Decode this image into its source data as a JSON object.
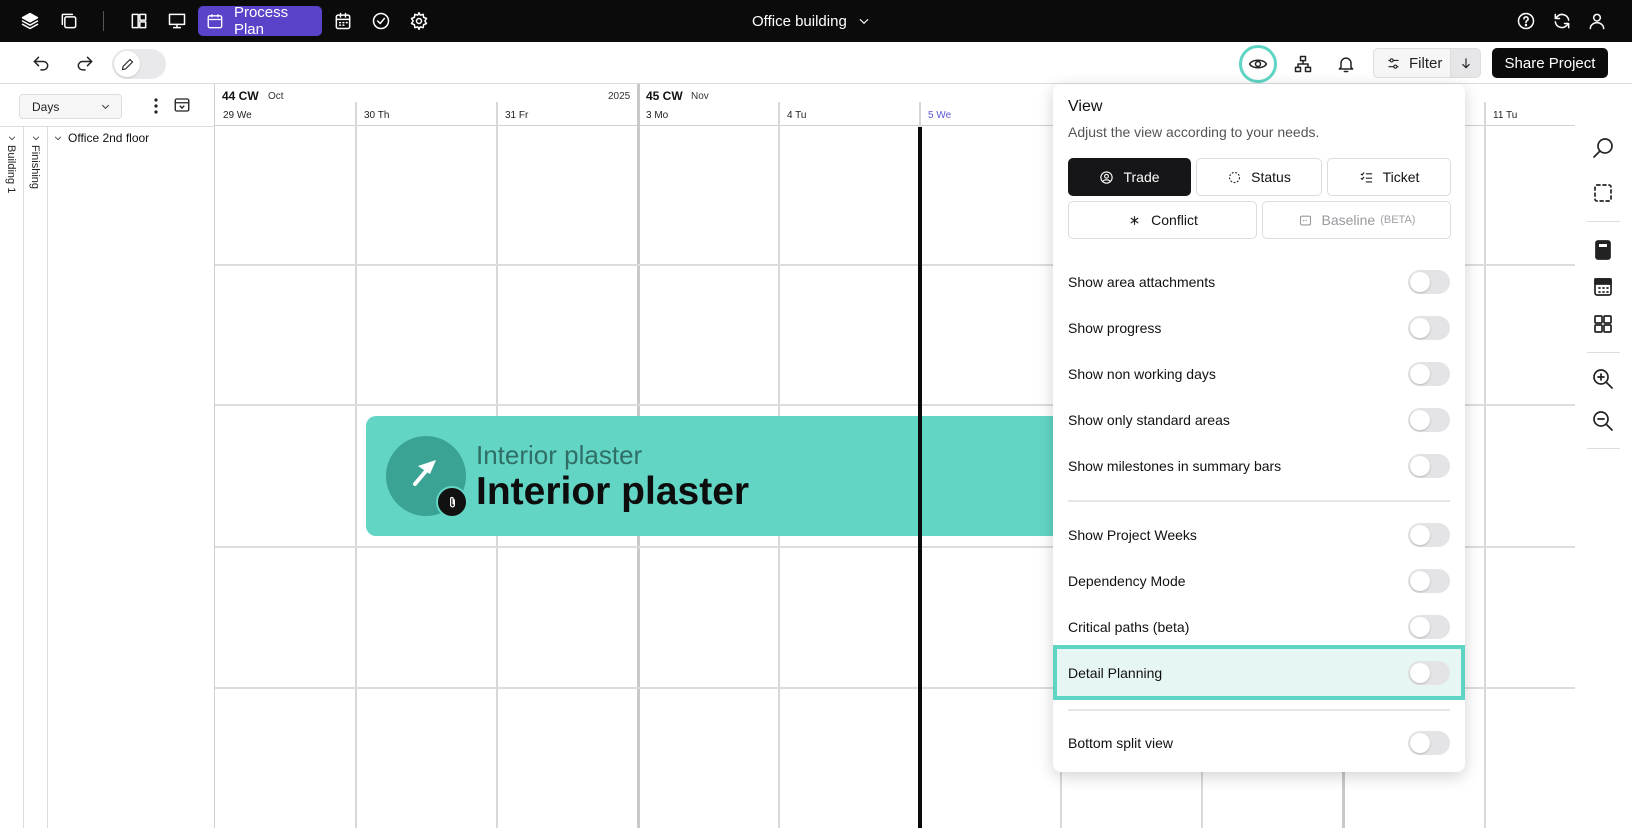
{
  "topbar": {
    "process_plan_label": "Process Plan",
    "project_title": "Office building"
  },
  "toolbar": {
    "filter_label": "Filter",
    "share_label": "Share Project"
  },
  "left_panel": {
    "zoom_select": "Days",
    "building_label": "Building 1",
    "trade_group_label": "Finishing",
    "floor_label": "Office 2nd floor"
  },
  "timeline": {
    "weeks": [
      {
        "label": "44 CW",
        "month": "Oct",
        "year": "2025"
      },
      {
        "label": "45 CW",
        "month": "Nov"
      }
    ],
    "days": [
      "29 We",
      "30 Th",
      "31 Fr",
      "3 Mo",
      "4 Tu",
      "5 We",
      "11 Tu"
    ],
    "today": "5 We"
  },
  "task_bar": {
    "subtitle": "Interior plaster",
    "title": "Interior plaster",
    "color": "#63d5c4"
  },
  "view_panel": {
    "title": "View",
    "subtitle": "Adjust the view according to your needs.",
    "modes": [
      {
        "label": "Trade",
        "active": true
      },
      {
        "label": "Status"
      },
      {
        "label": "Ticket"
      },
      {
        "label": "Conflict"
      },
      {
        "label": "Baseline",
        "badge": "(BETA)",
        "disabled": true
      }
    ],
    "options": [
      {
        "label": "Show area attachments",
        "on": false
      },
      {
        "label": "Show progress",
        "on": false
      },
      {
        "label": "Show non working days",
        "on": false
      },
      {
        "label": "Show only standard areas",
        "on": false
      },
      {
        "label": "Show milestones in summary bars",
        "on": false
      },
      {
        "label": "Show Project Weeks",
        "on": false
      },
      {
        "label": "Dependency Mode",
        "on": false
      },
      {
        "label": "Critical paths (beta)",
        "on": false
      },
      {
        "label": "Detail Planning",
        "on": false,
        "highlighted": true
      },
      {
        "label": "Bottom split view",
        "on": false
      }
    ]
  },
  "colors": {
    "accent": "#5b43c9",
    "highlight": "#5ed5c4",
    "today_label": "#5b57d9"
  }
}
